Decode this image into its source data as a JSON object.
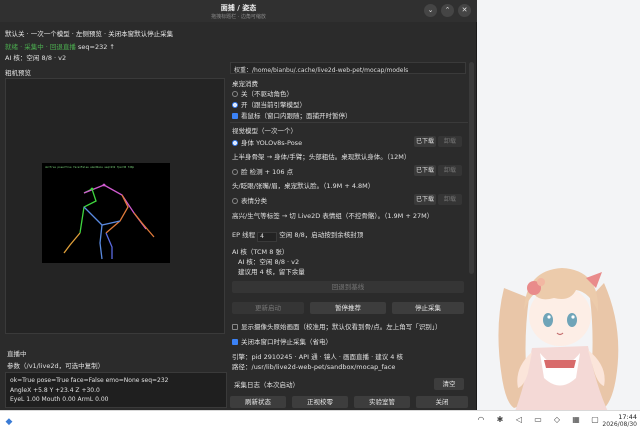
{
  "window": {
    "title": "面捕 / 姿态",
    "subtitle": "拖拽标题栏 · 边角可缩放",
    "controls": [
      "⌄",
      "⌃",
      "✕"
    ]
  },
  "header": {
    "hint": "默认关 · 一次一个模型 · 左侧预览 · 关闭本窗默认停止采集",
    "status_prefix": "就绪 · 采集中 · 回退直播",
    "status_seq": "seq=232 ↑",
    "ai_line": "AI 核：空闲 8/8 · v2"
  },
  "left": {
    "preview_title": "粗机预览",
    "pose_caption": "ok=True pose=True face=False emo=None seq=232  fps=30  720p",
    "live_label": "直播中",
    "params_label": "参数（/v1/live2d，可选中复制）",
    "params_lines": [
      "ok=True pose=True face=False emo=None seq=232",
      "AngleX +5.8  Y +23.4  Z +30.0",
      "EyeL 1.00  Mouth 0.00  ArmL 0.00"
    ]
  },
  "right": {
    "model_path": "权重：/home/bianbu/.cache/live2d-web-pet/mocap/models",
    "desktop_consume_title": "桌宠消费",
    "consume_options": [
      "关（不驱动角色）",
      "开（跟当前引擎模型）"
    ],
    "cursor_follow": "看鼠标（窗口内跟随；面捕开时暂停）",
    "vision_title": "视觉模型（一次一个）",
    "models": [
      {
        "name": "身体 YOLOv8s-Pose",
        "badge": "已下载",
        "action": "卸载"
      },
      {
        "name": "脸 检测 + 106 点",
        "badge": "已下载",
        "action": "卸载"
      },
      {
        "name": "表情分类",
        "badge": "已下载",
        "action": "卸载"
      }
    ],
    "model_descs": [
      "上半身骨架 → 身体/手臂；头部粗估。桌现默认身体。（12M）",
      "头/眨眼/张嘴/眉，桌宠默认脸。（1.9M + 4.8M）",
      "高兴/生气等标签 → 切 Live2D 表情组（不控骨骼）。（1.9M + 27M）"
    ],
    "ep_label": "EP 线程",
    "ep_value": "4",
    "ep_info": "空闲 8/8，启动按到余核封顶",
    "ai_core_title": "AI 核（TCM 8 张）",
    "ai_core_lines": [
      "AI 核：空闲 8/8 · v2",
      "建议用 4 核，留下余量"
    ],
    "rollback_button": "回退到基线",
    "buttons_row": [
      "更新启动",
      "暂停推荐",
      "停止采集"
    ],
    "show_camera": "显示摄像头原始画面（校准用；默认仅看到骨/点。左上角写「识别」）",
    "auto_stop": "关闭本窗口时停止采集（省电）",
    "engine_info": "引擎：pid 2910245 · API 通 · 镜人 · 画面直播 · 建议 4 核",
    "engine_path": "路径：/usr/lib/live2d-web-pet/sandbox/mocap_face",
    "log_title": "采集日志（本次启动）",
    "clear_button": "清空",
    "bottom_buttons": [
      "刷新状态",
      "正视校零",
      "实验室管",
      "关闭"
    ]
  },
  "taskbar": {
    "start_icon": "start-menu-icon",
    "tray_icons": [
      "wifi-icon",
      "bluetooth-icon",
      "volume-icon",
      "battery-icon",
      "network-icon",
      "keyboard-icon",
      "notification-icon"
    ],
    "time": "17:44",
    "date": "2026/08/30"
  }
}
